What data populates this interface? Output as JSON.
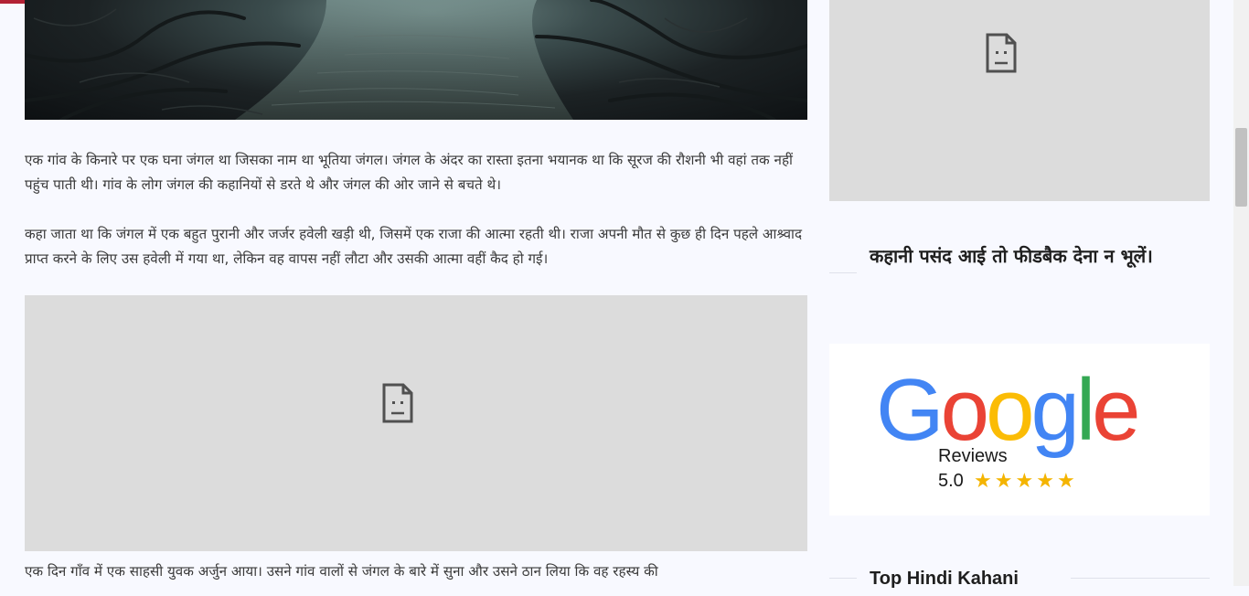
{
  "article": {
    "paragraph_1": "एक गांव के किनारे पर एक घना जंगल था जिसका नाम था भूतिया जंगल। जंगल के अंदर का रास्ता इतना भयानक था कि सूरज की रौशनी भी वहां तक नहीं पहुंच पाती थी। गांव के लोग जंगल की कहानियों से डरते थे और जंगल की ओर जाने से बचते थे।",
    "paragraph_2": "कहा जाता था कि जंगल में एक बहुत पुरानी और जर्जर हवेली खड़ी थी, जिसमें एक राजा की आत्मा रहती थी। राजा अपनी मौत से कुछ ही दिन पहले आश्र्वाद प्राप्त करने के लिए उस हवेली में गया था, लेकिन वह वापस नहीं लौटा और उसकी आत्मा वहीं कैद हो गई।",
    "paragraph_3": "एक दिन गाँव में एक साहसी युवक अर्जुन आया। उसने गांव वालों से जंगल के बारे में सुना और उसने ठान लिया कि वह रहस्य की"
  },
  "sidebar": {
    "feedback_title": "कहानी पसंद आई तो फीडबैक देना न भूलें।",
    "top_stories_title": "Top Hindi Kahani",
    "google_badge": {
      "brand": "Google",
      "label": "Reviews",
      "rating": "5.0",
      "stars": 5
    }
  },
  "icons": {
    "broken_image": "broken-image-icon",
    "star": "star-icon"
  },
  "colors": {
    "progress": "#b32235",
    "google_blue": "#4285f4",
    "google_red": "#ea4335",
    "google_yellow": "#fbbc05",
    "google_green": "#34a853",
    "star": "#f4b400"
  },
  "reading_progress": 0.23
}
